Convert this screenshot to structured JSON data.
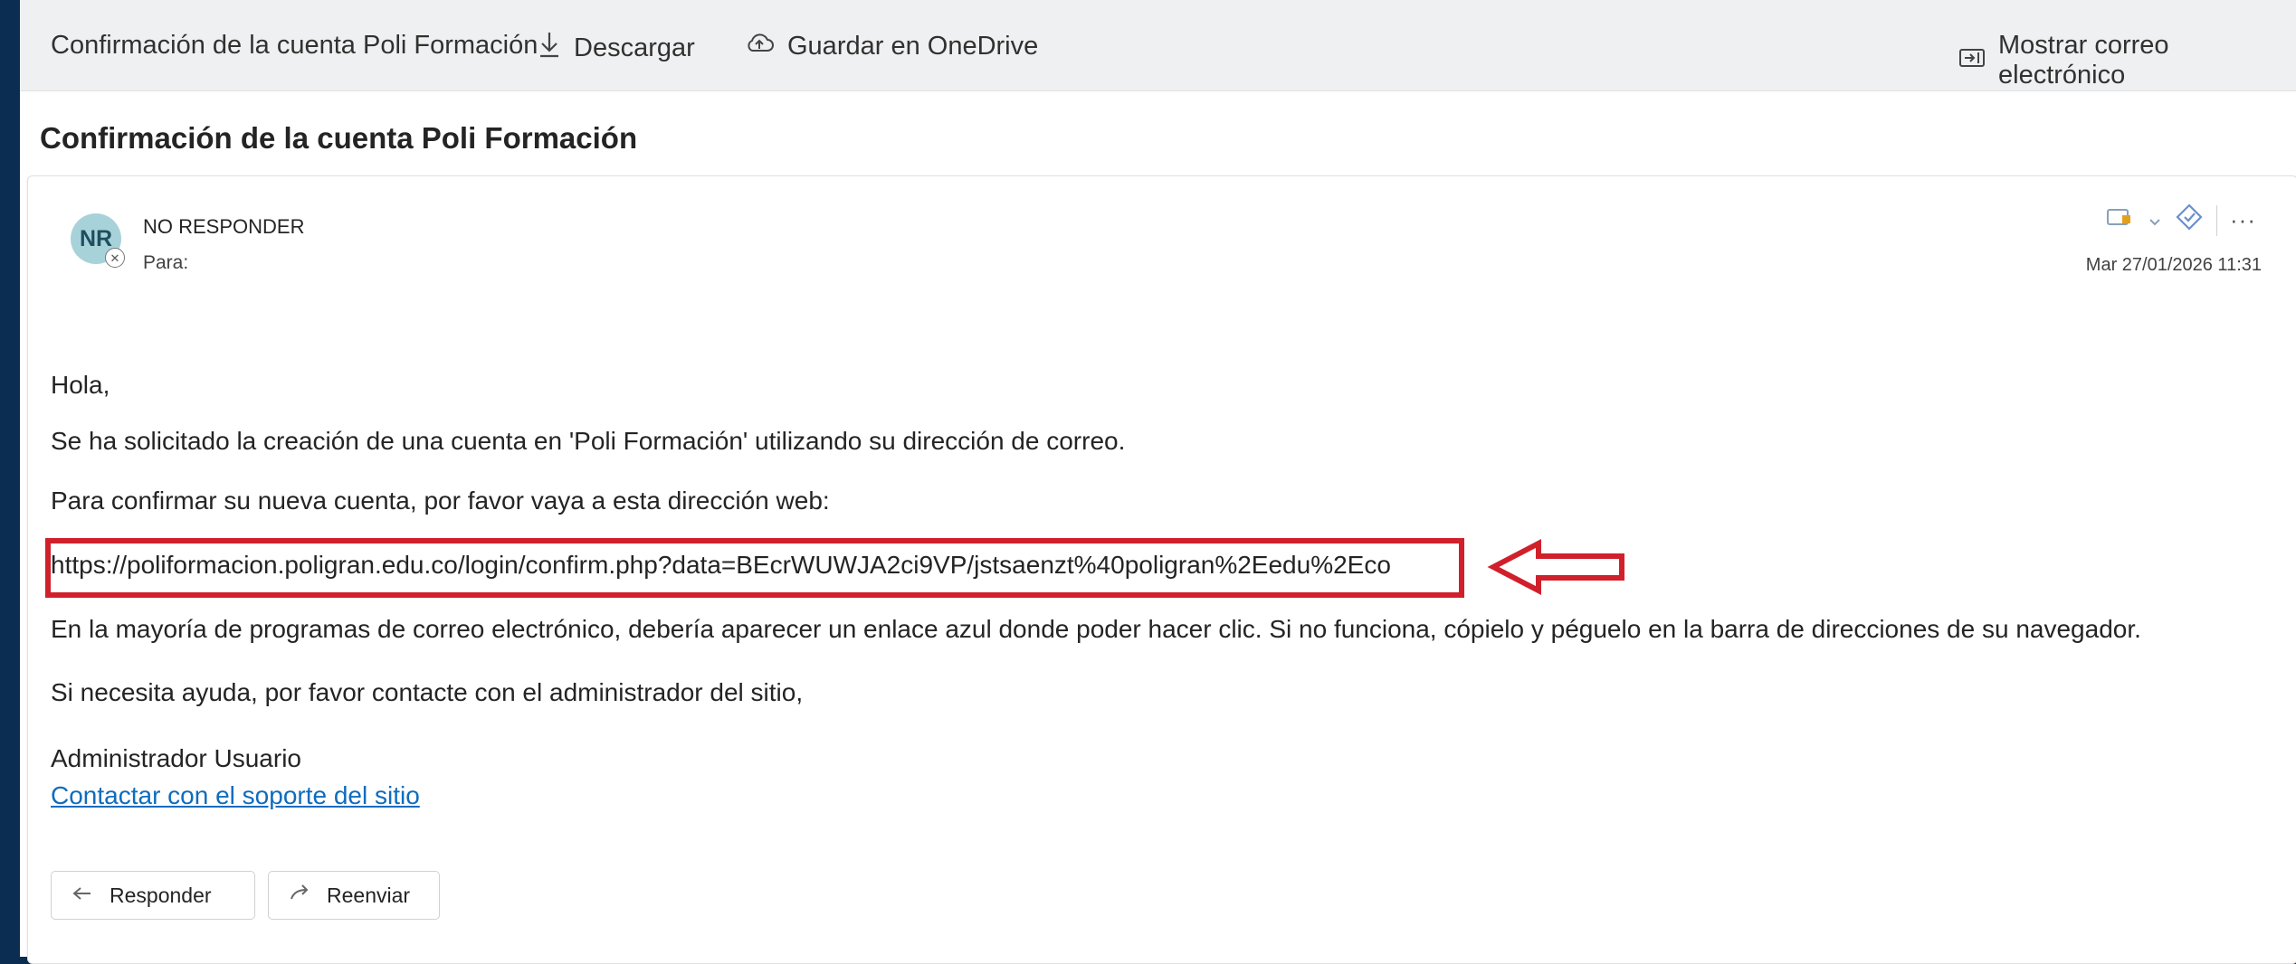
{
  "toolbar": {
    "attachment_name": "Confirmación de la cuenta Poli Formación",
    "download_label": "Descargar",
    "save_onedrive_label": "Guardar en OneDrive",
    "show_email_label": "Mostrar correo electrónico"
  },
  "message": {
    "subject": "Confirmación de la cuenta Poli Formación",
    "sender_initials": "NR",
    "sender_name": "NO RESPONDER",
    "to_label": "Para:",
    "date": "Mar 27/01/2026 11:31",
    "body": {
      "greeting": "Hola,",
      "line1": "Se ha solicitado la creación de una cuenta en 'Poli Formación' utilizando su dirección de correo.",
      "line2": "Para confirmar su nueva cuenta, por favor vaya a esta dirección web:",
      "confirm_url": "https://poliformacion.poligran.edu.co/login/confirm.php?data=BEcrWUWJA2ci9VP/jstsaenzt%40poligran%2Eedu%2Eco",
      "line3": "En la mayoría de programas de correo electrónico, debería aparecer un enlace azul donde poder hacer clic. Si no funciona, cópielo y péguelo en la barra de direcciones de su navegador.",
      "line4": "Si necesita ayuda, por favor contacte con el administrador del sitio,",
      "signature": "Administrador Usuario",
      "support_link": "Contactar con el soporte del sitio"
    }
  },
  "buttons": {
    "reply_label": "Responder",
    "forward_label": "Reenviar"
  },
  "colors": {
    "page_border": "#0b2d52",
    "highlight_box": "#d0202b",
    "link": "#0f6cbd"
  },
  "icons": {
    "download": "arrow-down-icon",
    "onedrive": "cloud-upload-icon",
    "show_email": "reading-pane-icon",
    "reply": "reply-arrow-icon",
    "forward": "forward-arrow-icon"
  }
}
